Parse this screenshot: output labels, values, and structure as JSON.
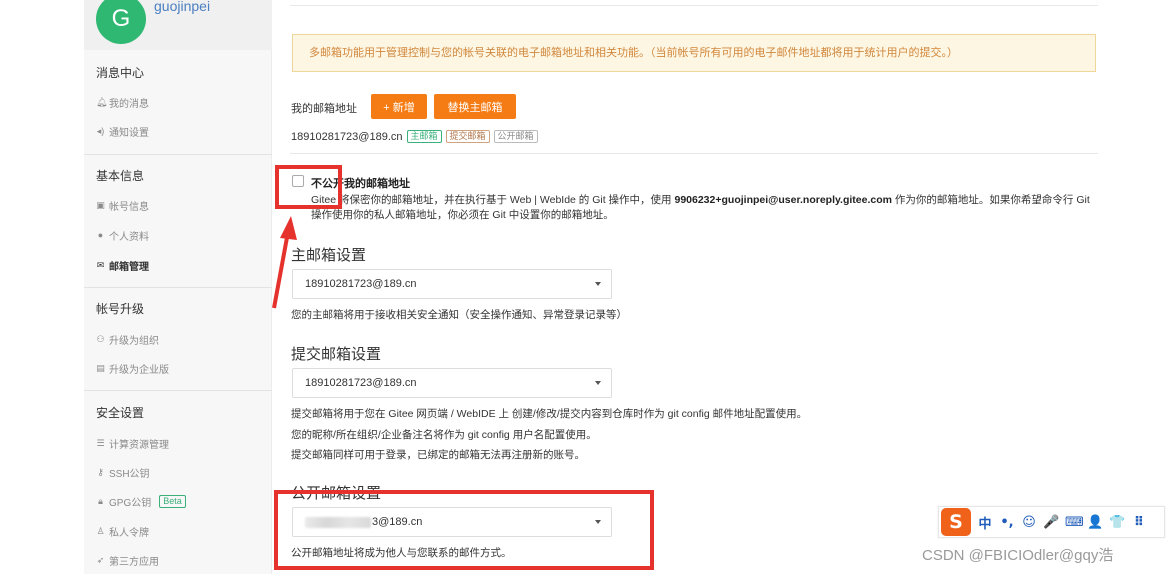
{
  "user": {
    "avatar_letter": "G",
    "name": "guojinpei"
  },
  "sidebar": {
    "sections": [
      {
        "title": "消息中心",
        "items": [
          {
            "icon": "bell-icon",
            "label": "我的消息"
          },
          {
            "icon": "volume-icon",
            "label": "通知设置"
          }
        ]
      },
      {
        "title": "基本信息",
        "items": [
          {
            "icon": "id-card-icon",
            "label": "帐号信息"
          },
          {
            "icon": "user-icon",
            "label": "个人资料"
          },
          {
            "icon": "envelope-icon",
            "label": "邮箱管理"
          }
        ]
      },
      {
        "title": "帐号升级",
        "items": [
          {
            "icon": "group-icon",
            "label": "升级为组织"
          },
          {
            "icon": "building-icon",
            "label": "升级为企业版"
          }
        ]
      },
      {
        "title": "安全设置",
        "items": [
          {
            "icon": "server-icon",
            "label": "计算资源管理"
          },
          {
            "icon": "key-icon",
            "label": "SSH公钥"
          },
          {
            "icon": "lock-icon",
            "label": "GPG公钥",
            "badge": "Beta"
          },
          {
            "icon": "token-icon",
            "label": "私人令牌"
          },
          {
            "icon": "rocket-icon",
            "label": "第三方应用"
          }
        ]
      }
    ]
  },
  "main": {
    "notice": "多邮箱功能用于管理控制与您的帐号关联的电子邮箱地址和相关功能。（当前帐号所有可用的电子邮件地址都将用于统计用户的提交。）",
    "my_email_label": "我的邮箱地址",
    "add_button": "+ 新增",
    "replace_button": "替换主邮箱",
    "email_address": "18910281723@189.cn",
    "tags": [
      "主邮箱",
      "提交邮箱",
      "公开邮箱"
    ],
    "private_checkbox_label": "不公开我的邮箱地址",
    "private_desc_1": "Gitee 将保密你的邮箱地址，并在执行基于 Web | WebIde 的 Git 操作中，使用 ",
    "private_desc_bold": "9906232+guojinpei@user.noreply.gitee.com",
    "private_desc_2": " 作为你的邮箱地址。如果你希望命令行 Git 操作使用你的私人邮箱地址，你必须在 Git 中设置你的邮箱地址。",
    "primary_title": "主邮箱设置",
    "primary_value": "18910281723@189.cn",
    "primary_help": "您的主邮箱将用于接收相关安全通知（安全操作通知、异常登录记录等）",
    "commit_title": "提交邮箱设置",
    "commit_value": "18910281723@189.cn",
    "commit_help_1": "提交邮箱将用于您在 Gitee 网页端 / WebIDE 上 创建/修改/提交内容到仓库时作为 git config 邮件地址配置使用。",
    "commit_help_2": "您的昵称/所在组织/企业备注名将作为 git config 用户名配置使用。",
    "commit_help_3": "提交邮箱同样可用于登录，已绑定的邮箱无法再注册新的账号。",
    "public_title": "公开邮箱设置",
    "public_value_suffix": "3@189.cn",
    "public_help": "公开邮箱地址将成为他人与您联系的邮件方式。"
  },
  "ime": {
    "logo": "S",
    "items": [
      "中",
      "•,",
      "☺",
      "🎤",
      "⌨",
      "👤",
      "👕",
      "⠿"
    ]
  },
  "watermark": "CSDN @FBICIOdler@gqy浩"
}
